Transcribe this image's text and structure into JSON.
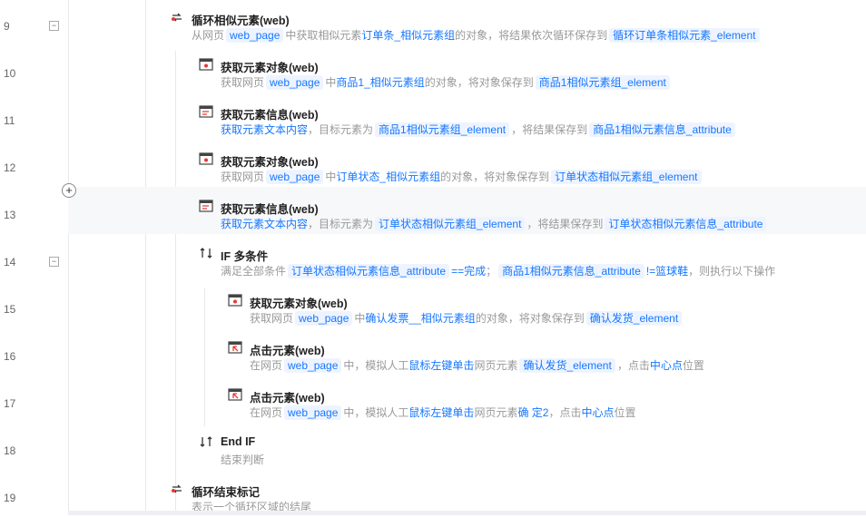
{
  "rows": [
    {
      "line": "9",
      "fold": "−",
      "icon": "loop-icon",
      "title": "循环相似元素(web)",
      "desc": [
        [
          "d",
          "从网页"
        ],
        [
          "v",
          "web_page"
        ],
        [
          "d",
          "中获取相似元素"
        ],
        [
          "h",
          "订单条_相似元素组"
        ],
        [
          "d",
          "的对象，将结果依次循环保存到"
        ],
        [
          "v",
          "循环订单条相似元素_element"
        ]
      ]
    },
    {
      "line": "10",
      "fold": "",
      "icon": "get-element-icon",
      "title": "获取元素对象(web)",
      "desc": [
        [
          "d",
          "获取网页"
        ],
        [
          "v",
          "web_page"
        ],
        [
          "d",
          "中"
        ],
        [
          "h",
          "商品1_相似元素组"
        ],
        [
          "d",
          "的对象，将对象保存到"
        ],
        [
          "v",
          "商品1相似元素组_element"
        ]
      ]
    },
    {
      "line": "11",
      "fold": "",
      "icon": "get-info-icon",
      "title": "获取元素信息(web)",
      "desc": [
        [
          "h",
          "获取元素文本内容"
        ],
        [
          "d",
          "，目标元素为"
        ],
        [
          "v",
          "商品1相似元素组_element"
        ],
        [
          "d",
          "，将结果保存到"
        ],
        [
          "v",
          "商品1相似元素信息_attribute"
        ]
      ]
    },
    {
      "line": "12",
      "fold": "",
      "icon": "get-element-icon",
      "title": "获取元素对象(web)",
      "desc": [
        [
          "d",
          "获取网页"
        ],
        [
          "v",
          "web_page"
        ],
        [
          "d",
          "中"
        ],
        [
          "h",
          "订单状态_相似元素组"
        ],
        [
          "d",
          "的对象，将对象保存到"
        ],
        [
          "v",
          "订单状态相似元素组_element"
        ]
      ]
    },
    {
      "line": "13",
      "fold": "",
      "icon": "get-info-icon",
      "title": "获取元素信息(web)",
      "desc": [
        [
          "h",
          "获取元素文本内容"
        ],
        [
          "d",
          "，目标元素为"
        ],
        [
          "v",
          "订单状态相似元素组_element"
        ],
        [
          "d",
          "，将结果保存到"
        ],
        [
          "v",
          "订单状态相似元素信息_attribute"
        ]
      ]
    },
    {
      "line": "14",
      "fold": "−",
      "icon": "if-icon",
      "title": "IF 多条件",
      "desc": [
        [
          "d",
          "满足全部条件"
        ],
        [
          "v",
          "订单状态相似元素信息_attribute"
        ],
        [
          "h",
          "==完成"
        ],
        [
          "d",
          "；"
        ],
        [
          "v",
          "商品1相似元素信息_attribute"
        ],
        [
          "h",
          "!=篮球鞋"
        ],
        [
          "d",
          "，则执行以下操作"
        ]
      ]
    },
    {
      "line": "15",
      "fold": "",
      "icon": "get-element-icon",
      "title": "获取元素对象(web)",
      "desc": [
        [
          "d",
          "获取网页"
        ],
        [
          "v",
          "web_page"
        ],
        [
          "d",
          "中"
        ],
        [
          "h",
          "确认发票__相似元素组"
        ],
        [
          "d",
          "的对象，将对象保存到"
        ],
        [
          "v",
          "确认发货_element"
        ]
      ]
    },
    {
      "line": "16",
      "fold": "",
      "icon": "click-icon",
      "title": "点击元素(web)",
      "desc": [
        [
          "d",
          "在网页"
        ],
        [
          "v",
          "web_page"
        ],
        [
          "d",
          "中，模拟人工"
        ],
        [
          "h",
          "鼠标左键单击"
        ],
        [
          "d",
          "网页元素"
        ],
        [
          "v",
          "确认发货_element"
        ],
        [
          "d",
          "，点击"
        ],
        [
          "h",
          "中心点"
        ],
        [
          "d",
          "位置"
        ]
      ]
    },
    {
      "line": "17",
      "fold": "",
      "icon": "click-icon",
      "title": "点击元素(web)",
      "desc": [
        [
          "d",
          "在网页"
        ],
        [
          "v",
          "web_page"
        ],
        [
          "d",
          "中，模拟人工"
        ],
        [
          "h",
          "鼠标左键单击"
        ],
        [
          "d",
          "网页元素"
        ],
        [
          "h",
          "确 定2"
        ],
        [
          "d",
          "，点击"
        ],
        [
          "h",
          "中心点"
        ],
        [
          "d",
          "位置"
        ]
      ]
    },
    {
      "line": "18",
      "fold": "",
      "icon": "end-if-icon",
      "title": "End IF",
      "desc": [
        [
          "d",
          "结束判断"
        ]
      ]
    },
    {
      "line": "19",
      "fold": "",
      "icon": "loop-end-icon",
      "title": "循环结束标记",
      "desc": [
        [
          "d",
          "表示一个循环区域的结尾"
        ]
      ]
    }
  ]
}
